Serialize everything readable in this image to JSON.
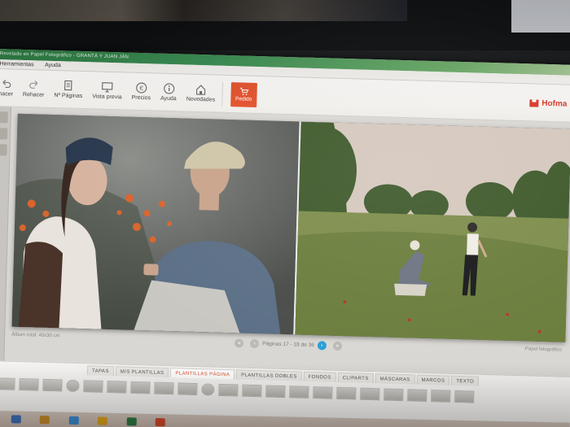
{
  "app": {
    "title_fragment": "Revelado en Papel Fotográfico - GRANTÁ Y JUAN JÁN",
    "menu": [
      "Herramientas",
      "Ayuda"
    ]
  },
  "toolbar": {
    "buttons": [
      {
        "label": "hacer",
        "icon": "undo-icon"
      },
      {
        "label": "Rehacer",
        "icon": "redo-icon"
      },
      {
        "label": "Nº Páginas",
        "icon": "pages-icon"
      },
      {
        "label": "Vista previa",
        "icon": "monitor-icon"
      },
      {
        "label": "Precios",
        "icon": "euro-icon"
      },
      {
        "label": "Ayuda",
        "icon": "info-icon"
      },
      {
        "label": "Novedades",
        "icon": "house-icon"
      }
    ],
    "order_label": "Pedido",
    "brand": "Hofma"
  },
  "pager": {
    "label": "Páginas 17 - 18 de 36",
    "left_info": "Álbum total: 40x30 cm",
    "right_info": "Papel fotográfico",
    "active_color": "#2a9fd8"
  },
  "tabs": [
    "TAPAS",
    "MIS PLANTILLAS",
    "PLANTILLAS PÁGINA",
    "PLANTILLAS DOBLES",
    "FONDOS",
    "CLIPARTS",
    "MÁSCARAS",
    "MARCOS",
    "TEXTO"
  ],
  "active_tab": "PLANTILLAS PÁGINA",
  "colors": {
    "accent": "#e2512b",
    "titlebar": "#2e7a43",
    "brand": "#d9372a"
  }
}
